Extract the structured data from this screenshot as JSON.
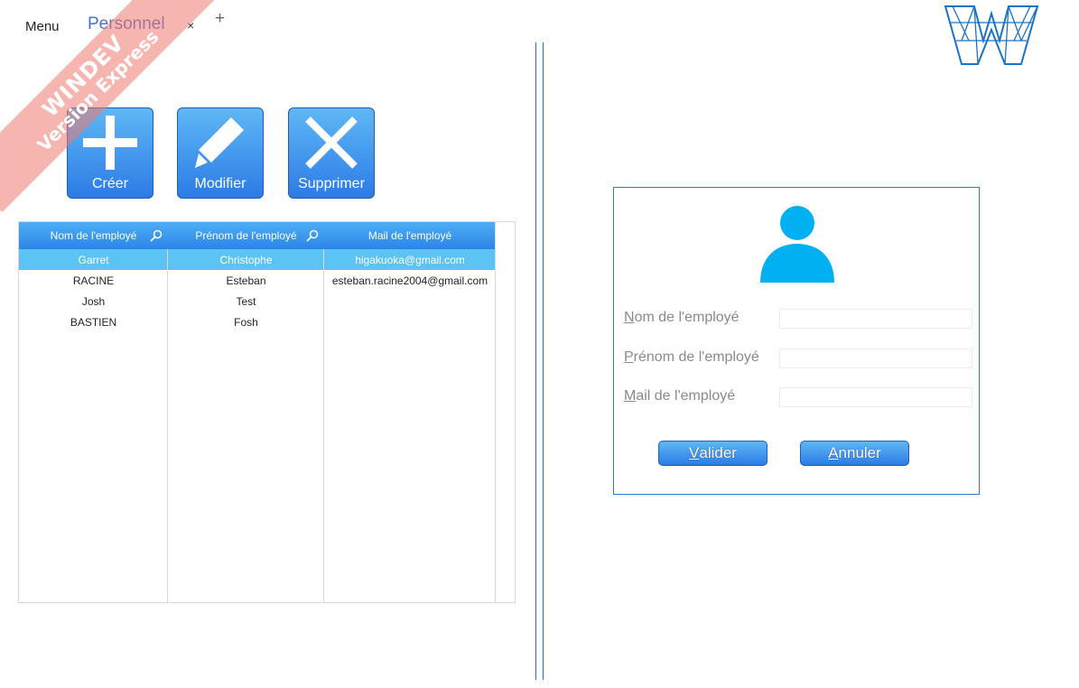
{
  "watermark": {
    "line1": "WINDEV",
    "line2": "Version Express"
  },
  "topbar": {
    "menu_label": "Menu",
    "tab_label": "Personnel",
    "close_glyph": "×",
    "add_glyph": "+"
  },
  "actions": {
    "create_label": "Créer",
    "edit_label": "Modifier",
    "delete_label": "Supprimer"
  },
  "table": {
    "headers": [
      "Nom de l'employé",
      "Prénom de l'employé",
      "Mail de l'employé"
    ],
    "rows": [
      {
        "nom": "Garret",
        "prenom": "Christophe",
        "mail": "higakuoka@gmail.com",
        "selected": true
      },
      {
        "nom": "RACINE",
        "prenom": "Esteban",
        "mail": "esteban.racine2004@gmail.com",
        "selected": false
      },
      {
        "nom": "Josh",
        "prenom": "Test",
        "mail": "",
        "selected": false
      },
      {
        "nom": "BASTIEN",
        "prenom": "Fosh",
        "mail": "",
        "selected": false
      }
    ]
  },
  "form": {
    "nom_label_first": "N",
    "nom_label_rest": "om de l'employé",
    "prenom_label_first": "P",
    "prenom_label_rest": "rénom de l'employé",
    "mail_label_first": "M",
    "mail_label_rest": "ail de l'employé",
    "nom_value": "",
    "prenom_value": "",
    "mail_value": "",
    "validate_first": "V",
    "validate_rest": "alider",
    "cancel_first": "A",
    "cancel_rest": "nnuler"
  },
  "colors": {
    "accent": "#2c7be6",
    "selected_row": "#5bc4f5",
    "avatar": "#00b0f0",
    "divider": "#1e6ec8"
  },
  "icons": {
    "create": "plus-icon",
    "edit": "pencil-icon",
    "delete": "cross-icon",
    "search": "magnifier-icon",
    "avatar": "user-silhouette-icon",
    "logo": "windev-w-logo"
  }
}
